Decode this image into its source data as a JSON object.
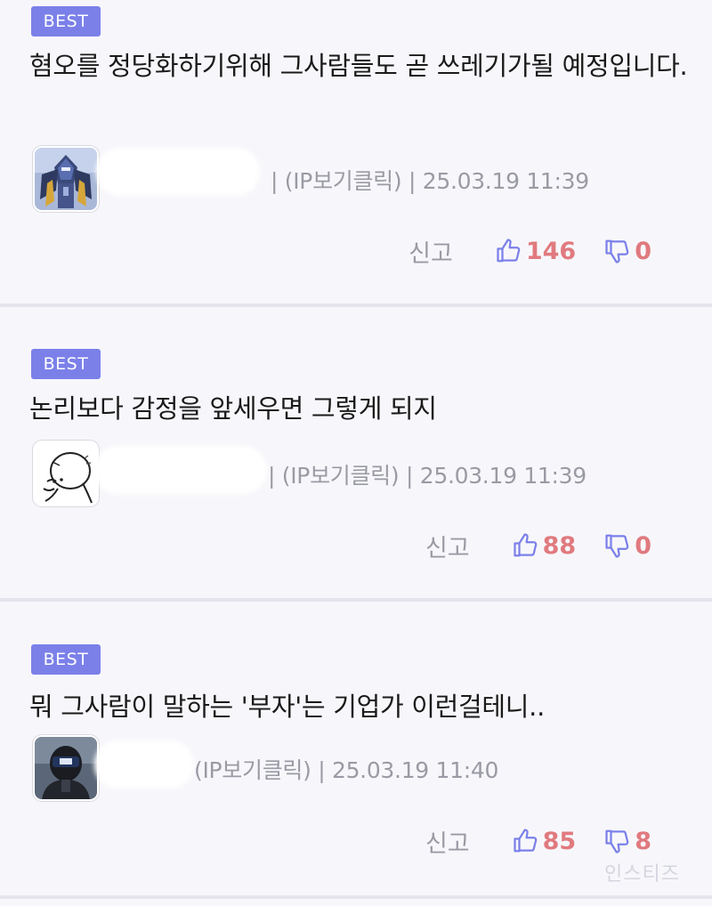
{
  "comments": [
    {
      "badge": "BEST",
      "text": "혐오를 정당화하기위해 그사람들도 곧 쓰레기가될 예정입니다.",
      "meta": "| (IP보기클릭) | 25.03.19 11:39",
      "report": "신고",
      "likes": "146",
      "dislikes": "0",
      "avatar_icon": "robot-mech-avatar-icon"
    },
    {
      "badge": "BEST",
      "text": "논리보다 감정을 앞세우면 그렇게 되지",
      "meta": "| (IP보기클릭) | 25.03.19 11:39",
      "report": "신고",
      "likes": "88",
      "dislikes": "0",
      "avatar_icon": "sketch-face-avatar-icon"
    },
    {
      "badge": "BEST",
      "text": "뭐 그사람이 말하는 '부자'는 기업가 이런걸테니..",
      "meta": "(IP보기클릭) | 25.03.19 11:40",
      "report": "신고",
      "likes": "85",
      "dislikes": "8",
      "avatar_icon": "helmet-person-avatar-icon"
    }
  ],
  "watermark": "인스티즈",
  "colors": {
    "badge": "#7b80e9",
    "like_count": "#e07a7f",
    "thumb_icon": "#7b80e9",
    "meta_text": "#9a9aa4",
    "background": "#f7f7fb",
    "divider": "#e4e4ec"
  }
}
